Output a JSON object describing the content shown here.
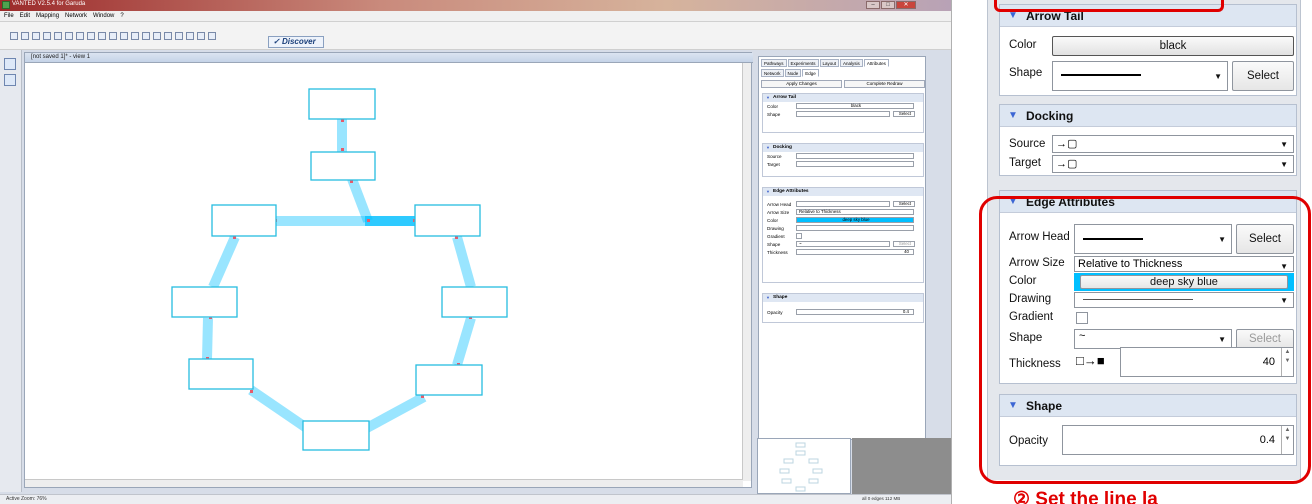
{
  "app": {
    "title": "VANTED V2.5.4 for Garuda",
    "menus": [
      "File",
      "Edit",
      "Mapping",
      "Network",
      "Window",
      "?"
    ],
    "discover_label": "Discover",
    "view_title": "[not saved 1]* - view 1",
    "panel_tabs": [
      "Pathways",
      "Experiments",
      "Layout",
      "Analysis",
      "Attributes"
    ],
    "panel_subtabs": [
      "Network",
      "Node",
      "Edge"
    ],
    "apply_changes": "Apply Changes",
    "complete_redraw": "Complete Redraw",
    "status_left": "Active Zoom: 76%",
    "status_right": "all  0 edges  112 MB"
  },
  "panel": {
    "arrow_tail": {
      "title": "Arrow Tail",
      "color_label": "Color",
      "color_value": "black",
      "shape_label": "Shape",
      "select_label": "Select"
    },
    "docking": {
      "title": "Docking",
      "source_label": "Source",
      "target_label": "Target"
    },
    "edge_attributes": {
      "title": "Edge Attributes",
      "arrow_head_label": "Arrow Head",
      "select_label": "Select",
      "arrow_size_label": "Arrow Size",
      "arrow_size_value": "Relative to Thickness",
      "color_label": "Color",
      "color_value": "deep sky blue",
      "drawing_label": "Drawing",
      "gradient_label": "Gradient",
      "shape_label": "Shape",
      "shape_value": "~",
      "shape_select_label": "Select",
      "thickness_label": "Thickness",
      "thickness_value": "40"
    },
    "shape": {
      "title": "Shape",
      "opacity_label": "Opacity",
      "opacity_value": "0.4"
    }
  },
  "colors": {
    "edge": "#00bfff",
    "node_border": "#26bde0",
    "highlight": "#e00000",
    "deep_sky_blue_field": "#00bfff"
  },
  "annotation": {
    "step_text": "② Set the line la"
  }
}
